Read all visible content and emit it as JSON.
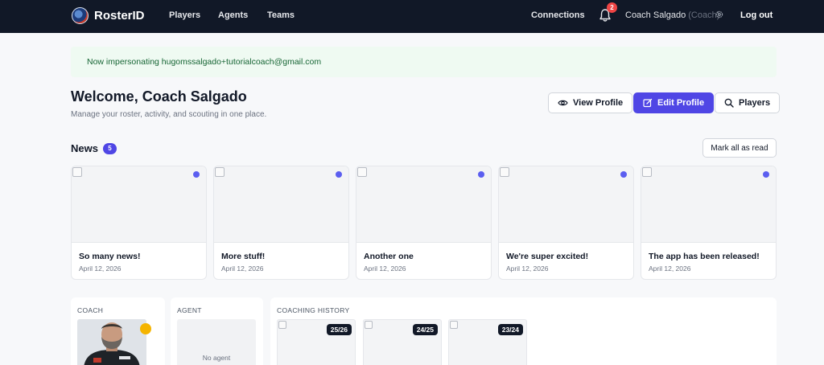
{
  "nav": {
    "brand": "RosterID",
    "links": [
      "Players",
      "Agents",
      "Teams"
    ],
    "connections": "Connections",
    "notifications_count": "2",
    "user_name": "Coach Salgado",
    "user_role": "(Coach)",
    "logout": "Log out"
  },
  "banner": {
    "message": "Now impersonating hugomssalgado+tutorialcoach@gmail.com"
  },
  "header": {
    "welcome": "Welcome, Coach Salgado",
    "subtitle": "Manage your roster, activity, and scouting in one place.",
    "view_profile": "View Profile",
    "edit_profile": "Edit Profile",
    "players": "Players"
  },
  "news": {
    "title": "News",
    "count": "5",
    "mark_all_read": "Mark all as read",
    "items": [
      {
        "title": "So many news!",
        "date": "April 12, 2026"
      },
      {
        "title": "More stuff!",
        "date": "April 12, 2026"
      },
      {
        "title": "Another one",
        "date": "April 12, 2026"
      },
      {
        "title": "We're super excited!",
        "date": "April 12, 2026"
      },
      {
        "title": "The app has been released!",
        "date": "April 12, 2026"
      }
    ]
  },
  "coach": {
    "label": "COACH"
  },
  "agent": {
    "label": "AGENT",
    "empty": "No agent"
  },
  "history": {
    "label": "COACHING HISTORY",
    "seasons": [
      "25/26",
      "24/25",
      "23/24"
    ]
  },
  "colors": {
    "nav_bg": "#111827",
    "accent": "#4f46e5",
    "banner_bg": "#effaf2",
    "banner_text": "#166534",
    "unread_dot": "#5b5ef0",
    "notification_badge": "#ef4444",
    "status_dot": "#f5b400"
  }
}
